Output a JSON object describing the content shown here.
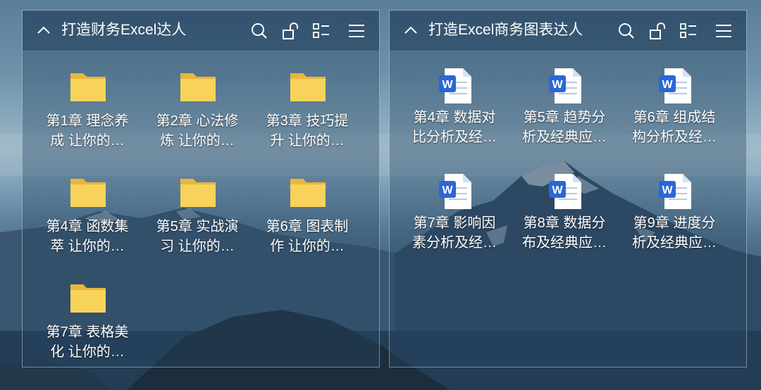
{
  "left_group": {
    "title": "打造财务Excel达人",
    "items": [
      {
        "line1": "第1章 理念养",
        "line2": "成 让你的…",
        "icon": "folder-icon"
      },
      {
        "line1": "第2章 心法修",
        "line2": "炼 让你的…",
        "icon": "folder-icon"
      },
      {
        "line1": "第3章 技巧提",
        "line2": "升 让你的…",
        "icon": "folder-icon"
      },
      {
        "line1": "第4章 函数集",
        "line2": "萃 让你的…",
        "icon": "folder-icon"
      },
      {
        "line1": "第5章 实战演",
        "line2": "习 让你的…",
        "icon": "folder-icon"
      },
      {
        "line1": "第6章 图表制",
        "line2": "作 让你的…",
        "icon": "folder-icon"
      },
      {
        "line1": "第7章 表格美",
        "line2": "化 让你的…",
        "icon": "folder-icon"
      }
    ]
  },
  "right_group": {
    "title": "打造Excel商务图表达人",
    "items": [
      {
        "line1": "第4章 数据对",
        "line2": "比分析及经…",
        "icon": "word-document-icon"
      },
      {
        "line1": "第5章 趋势分",
        "line2": "析及经典应…",
        "icon": "word-document-icon"
      },
      {
        "line1": "第6章 组成结",
        "line2": "构分析及经…",
        "icon": "word-document-icon"
      },
      {
        "line1": "第7章 影响因",
        "line2": "素分析及经…",
        "icon": "word-document-icon"
      },
      {
        "line1": "第8章 数据分",
        "line2": "布及经典应…",
        "icon": "word-document-icon"
      },
      {
        "line1": "第9章 进度分",
        "line2": "析及经典应…",
        "icon": "word-document-icon"
      }
    ]
  },
  "header_icons": [
    "chevron-up-icon",
    "search-icon",
    "lock-icon",
    "view-mode-icon",
    "menu-icon"
  ],
  "colors": {
    "folder": "#f7cd4f",
    "word_blue": "#2b67d6",
    "fence_bg": "rgba(40,70,100,0.38)"
  }
}
